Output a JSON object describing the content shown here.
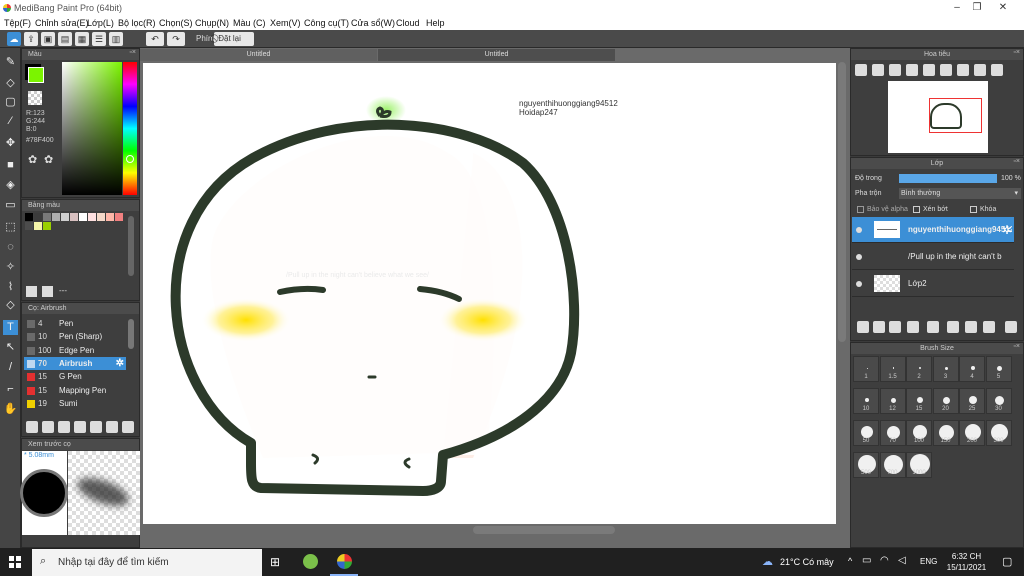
{
  "window": {
    "title": "MediBang Paint Pro (64bit)",
    "minimize": "–",
    "maximize": "❐",
    "close": "✕"
  },
  "menu": [
    "Tệp(F)",
    "Chỉnh sửa(E)",
    "Lớp(L)",
    "Bộ lọc(R)",
    "Chọn(S)",
    "Chụp(N)",
    "Màu (C)",
    "Xem(V)",
    "Công cụ(T)",
    "Cửa sổ(W)",
    "Cloud",
    "Help"
  ],
  "toolbar": {
    "undo": "↶",
    "redo": "↷",
    "shortcut_label": "Phím",
    "reset_label": "Đặt lại"
  },
  "color_panel": {
    "title": "Màu",
    "r": "R:123",
    "g": "G:244",
    "b": "B:0",
    "hex": "#78F400",
    "primary_color": "#7bf400",
    "secondary_color": "#000000"
  },
  "swatch_panel": {
    "title": "Bảng màu",
    "colors": [
      "#000000",
      "#3b3b3b",
      "#7a7a7a",
      "#b0b0b0",
      "#cfcfcf",
      "#d8c0c0",
      "#ffffff",
      "#ffe0e0",
      "#f5d8c8",
      "#ffb6a8",
      "#f28080",
      "#4c4c4c",
      "#f5f5aa",
      "#9ad000"
    ],
    "footer": "---"
  },
  "brush_panel": {
    "title": "Cọ: Airbrush",
    "brushes": [
      {
        "size": "4",
        "name": "Pen",
        "color": "#6a6a6a"
      },
      {
        "size": "10",
        "name": "Pen (Sharp)",
        "color": "#6a6a6a"
      },
      {
        "size": "100",
        "name": "Edge Pen",
        "color": "#6a6a6a"
      },
      {
        "size": "70",
        "name": "Airbrush",
        "color": "#c0d8f0"
      },
      {
        "size": "15",
        "name": "G Pen",
        "color": "#e53030"
      },
      {
        "size": "15",
        "name": "Mapping Pen",
        "color": "#e53030"
      },
      {
        "size": "19",
        "name": "Sumi",
        "color": "#f0d000"
      }
    ]
  },
  "preview_panel": {
    "title": "Xem trước cọ",
    "size": "* 5.08mm"
  },
  "canvas": {
    "tabs": [
      "Untitled",
      "Untitled"
    ],
    "watermark": "nguyenthihuonggiang94512",
    "watermark2": "Hoidap247",
    "faint_text": "/Pull up in the night can't believe what we see/"
  },
  "navigator": {
    "title": "Hoa tiêu"
  },
  "layer_panel": {
    "title": "Lớp",
    "opacity_label": "Độ trong",
    "opacity_value": "100 %",
    "opacity_pct": 100,
    "blend_label": "Pha trộn",
    "blend_value": "Bình thường",
    "protect_alpha": "Bảo vệ alpha",
    "clip": "Xén bớt",
    "lock": "Khóa",
    "layers": [
      {
        "name": "nguyenthihuonggiang94512"
      },
      {
        "name": "/Pull up in the night can't b"
      },
      {
        "name": "Lớp2"
      }
    ]
  },
  "brush_size": {
    "title": "Brush Size",
    "sizes": [
      "1",
      "1.5",
      "2",
      "3",
      "4",
      "5",
      "10",
      "12",
      "15",
      "20",
      "25",
      "30",
      "50",
      "70",
      "100",
      "150",
      "200",
      "300",
      "500",
      "700",
      "1000"
    ]
  },
  "taskbar": {
    "search_placeholder": "Nhập tại đây để tìm kiếm",
    "weather": "21°C  Có mây",
    "lang": "ENG",
    "time": "6:32 CH",
    "date": "15/11/2021"
  }
}
